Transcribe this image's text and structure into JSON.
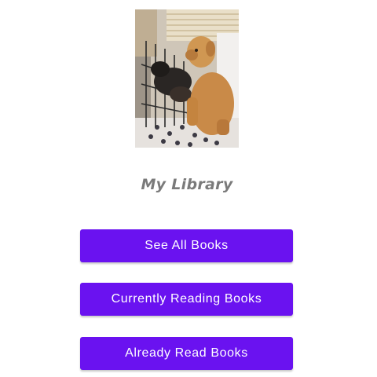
{
  "header_image": {
    "subject": "two dogs at a window"
  },
  "library": {
    "title": "My Library"
  },
  "buttons": {
    "see_all_books": "See All Books",
    "currently_reading_books": "Currently Reading Books",
    "already_read_books": "Already Read Books"
  },
  "colors": {
    "accent": "#6a12f0",
    "title_text": "#7a7a7a",
    "button_text": "#ffffff",
    "background": "#ffffff"
  }
}
